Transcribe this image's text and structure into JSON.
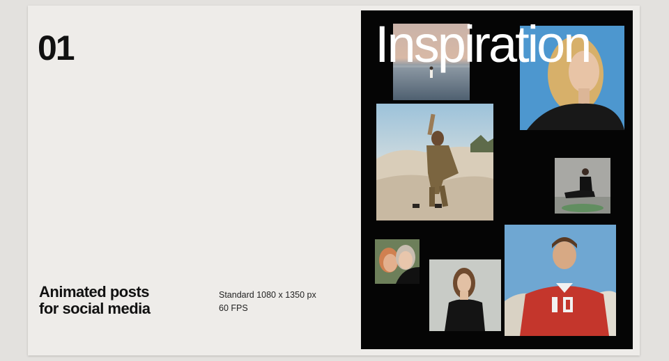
{
  "slide": {
    "number": "01",
    "title_lines": [
      "Animated posts",
      "for social media"
    ],
    "spec_lines": [
      "Standard 1080 x 1350 px",
      "60 FPS"
    ]
  },
  "poster": {
    "title": "Inspiration",
    "background": "#050505",
    "photos": [
      {
        "name": "photo-beach-figure"
      },
      {
        "name": "photo-blonde-portrait"
      },
      {
        "name": "photo-woman-on-rocks"
      },
      {
        "name": "photo-seated-figure"
      },
      {
        "name": "photo-two-faces"
      },
      {
        "name": "photo-woman-black-dress"
      },
      {
        "name": "photo-man-red-jersey"
      }
    ]
  },
  "colors": {
    "page_bg": "#e3e1de",
    "card_bg": "#eeece9",
    "text": "#111111"
  }
}
